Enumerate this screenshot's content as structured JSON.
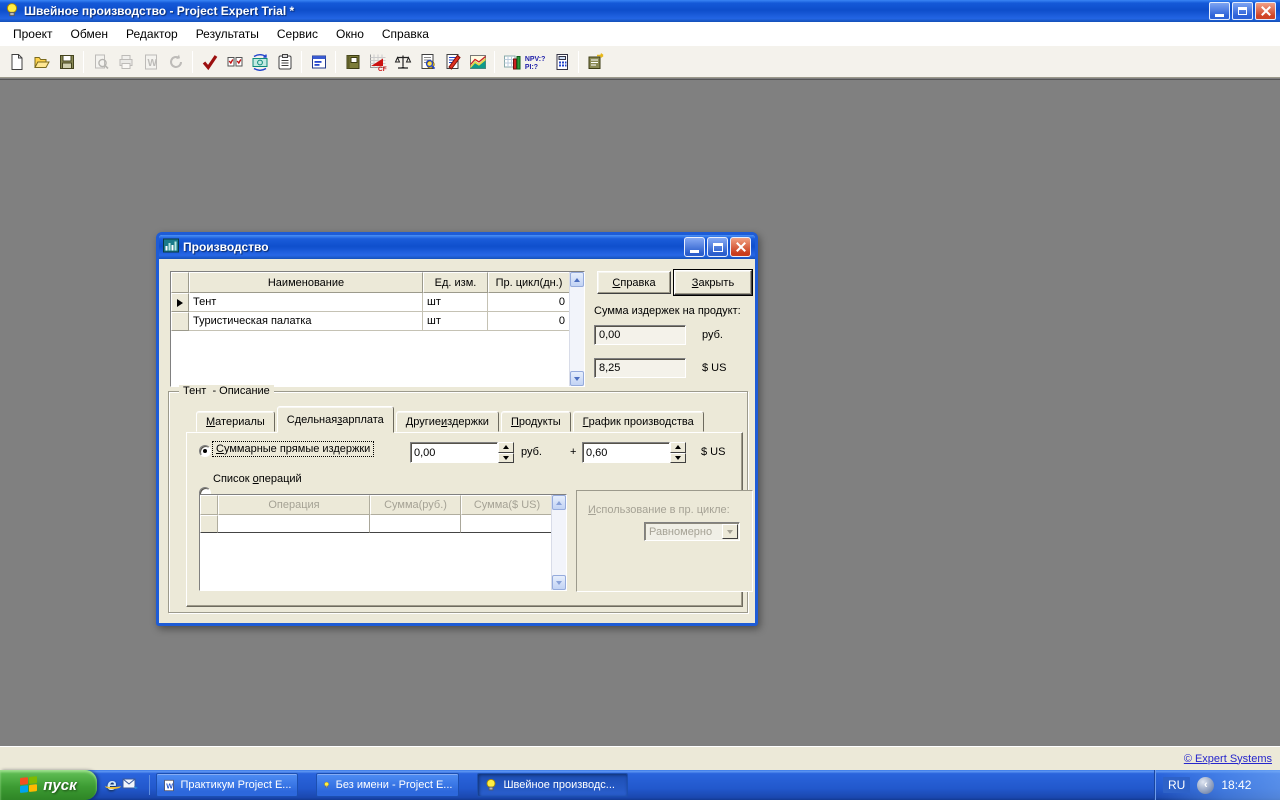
{
  "window": {
    "title": "Швейное производство - Project Expert Trial *"
  },
  "menu": {
    "items": [
      "Проект",
      "Обмен",
      "Редактор",
      "Результаты",
      "Сервис",
      "Окно",
      "Справка"
    ]
  },
  "toolbar": {
    "cf_label": "CF",
    "npv_label": "NPV:?",
    "pi_label": "PI:?",
    "icons": [
      "new-document-icon",
      "open-project-icon",
      "save-icon",
      "print-preview-icon",
      "print-icon",
      "word-report-icon",
      "refresh-icon",
      "validate-check-icon",
      "checklist-icon",
      "money-exchange-icon",
      "notes-icon",
      "project-dialogs-icon",
      "company-book-icon",
      "cash-flow-icon",
      "scales-icon",
      "analysis-document-icon",
      "edit-document-icon",
      "profitability-chart-icon",
      "detail-tables-icon",
      "npv-indicators-icon",
      "calculator-icon",
      "reports-icon"
    ]
  },
  "statusbar": {
    "link": "© Expert Systems"
  },
  "taskbar": {
    "start_label": "пуск",
    "quicklaunch": {
      "ie_glyph": "e"
    },
    "tasks": [
      {
        "label": "Практикум Project E...",
        "icon_letter": "W"
      },
      {
        "label": "Без имени - Project E..."
      },
      {
        "label": "Швейное производс..."
      }
    ],
    "tray": {
      "language": "RU",
      "time": "18:42"
    }
  },
  "dialog": {
    "title": "Производство",
    "products_table": {
      "headers": [
        "Наименование",
        "Ед. изм.",
        "Пр. цикл(дн.)"
      ],
      "rows": [
        {
          "name": "Тент",
          "unit": "шт",
          "cycle": "0"
        },
        {
          "name": "Туристическая палатка",
          "unit": "шт",
          "cycle": "0"
        }
      ]
    },
    "help_button": {
      "text": "Справка",
      "u": 0
    },
    "close_button": {
      "text": "Закрыть",
      "u": 0
    },
    "cost_label": "Сумма издержек на продукт:",
    "cost_rub": {
      "value": "0,00",
      "unit": "руб."
    },
    "cost_usd": {
      "value": "8,25",
      "unit": "$ US"
    },
    "group_title": "Тент  - Описание",
    "tabs": [
      {
        "text": "Материалы",
        "u": 0
      },
      {
        "text": "Сдельная зарплата",
        "u": 9
      },
      {
        "text": "Другие издержки",
        "u": 7
      },
      {
        "text": "Продукты",
        "u": 0
      },
      {
        "text": "График производства",
        "u": 0
      }
    ],
    "radio_total": {
      "text": "Суммарные прямые издержки",
      "u": 0
    },
    "radio_list": {
      "text": "Список операций",
      "u": 7
    },
    "direct_rub": {
      "value": "0,00",
      "unit": "руб."
    },
    "plus": "+",
    "direct_usd": {
      "value": "0,60",
      "unit": "$ US"
    },
    "operations_table": {
      "headers": [
        "Операция",
        "Сумма(руб.)",
        "Сумма($ US)"
      ]
    },
    "usage_label": {
      "text": "Использование в пр. цикле:",
      "u": 0
    },
    "usage_value": "Равномерно"
  }
}
